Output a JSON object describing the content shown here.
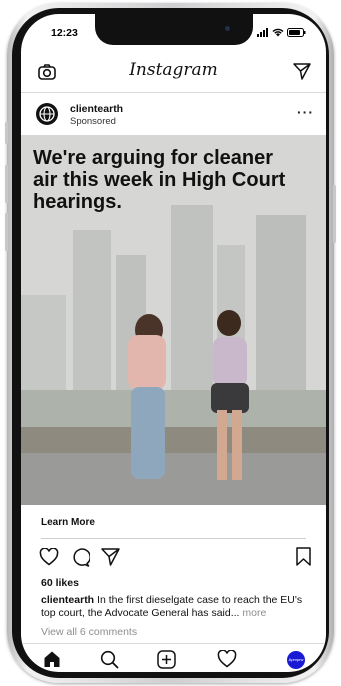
{
  "status_bar": {
    "time": "12:23"
  },
  "header": {
    "app_name": "Instagram"
  },
  "post": {
    "account": "clientearth",
    "sponsored_label": "Sponsored",
    "headline": "We're arguing for cleaner air this week in High Court hearings.",
    "cta_label": "Learn More",
    "likes": "60 likes",
    "caption_account": "clientearth",
    "caption_text": " In the first dieselgate case to reach the EU's top court, the Advocate General has said...",
    "caption_more": " more",
    "view_comments": "View all 6 comments"
  },
  "tabbar": {
    "profile_label": "Apmprw"
  },
  "icons": [
    "camera-icon",
    "direct-send-icon",
    "more-options-icon",
    "heart-icon",
    "comment-icon",
    "share-icon",
    "bookmark-icon",
    "home-icon",
    "search-icon",
    "new-post-icon",
    "activity-heart-icon",
    "profile-avatar"
  ],
  "colors": {
    "profile_accent": "#1a1ad4",
    "secondary_text": "#8e8e8e"
  }
}
